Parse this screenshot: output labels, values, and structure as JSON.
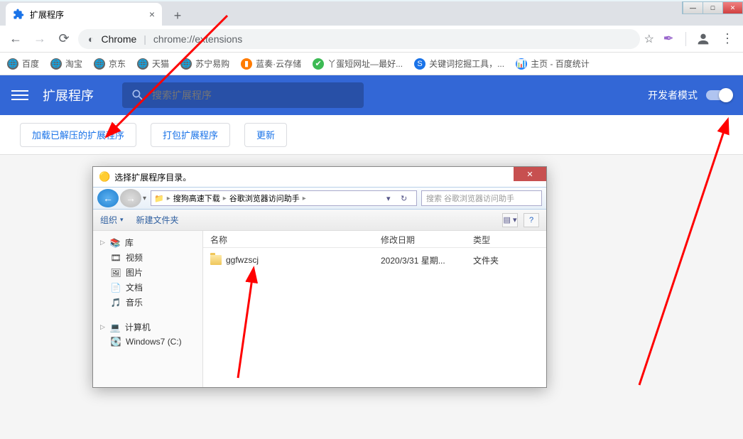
{
  "tab": {
    "title": "扩展程序"
  },
  "address": {
    "prefix": "Chrome",
    "url": "chrome://extensions"
  },
  "bookmarks": [
    {
      "icon_bg": "#666",
      "glyph": "🌐",
      "label": "百度"
    },
    {
      "icon_bg": "#666",
      "glyph": "🌐",
      "label": "淘宝"
    },
    {
      "icon_bg": "#666",
      "glyph": "🌐",
      "label": "京东"
    },
    {
      "icon_bg": "#666",
      "glyph": "🌐",
      "label": "天猫"
    },
    {
      "icon_bg": "#666",
      "glyph": "🌐",
      "label": "苏宁易购"
    },
    {
      "icon_bg": "#ff7b00",
      "glyph": "▮",
      "label": "蓝奏·云存储"
    },
    {
      "icon_bg": "#3cba54",
      "glyph": "✔",
      "label": "丫蛋短网址—最好..."
    },
    {
      "icon_bg": "#1a73e8",
      "glyph": "S",
      "label": "关键词挖掘工具，..."
    },
    {
      "icon_bg": "#2080ff",
      "glyph": "📊",
      "label": "主页 - 百度统计"
    }
  ],
  "ext_header": {
    "title": "扩展程序",
    "search_placeholder": "搜索扩展程序",
    "dev_mode_label": "开发者模式"
  },
  "ext_buttons": {
    "load_unpacked": "加载已解压的扩展程序",
    "pack": "打包扩展程序",
    "update": "更新"
  },
  "dialog": {
    "title": "选择扩展程序目录。",
    "breadcrumb": [
      "搜狗高速下载",
      "谷歌浏览器访问助手"
    ],
    "search_placeholder": "搜索 谷歌浏览器访问助手",
    "toolbar": {
      "organize": "组织",
      "new_folder": "新建文件夹"
    },
    "sidebar": {
      "library": "库",
      "items": [
        "视频",
        "图片",
        "文档",
        "音乐"
      ],
      "computer": "计算机",
      "drives": [
        "Windows7 (C:)"
      ]
    },
    "file_headers": {
      "name": "名称",
      "date": "修改日期",
      "type": "类型"
    },
    "files": [
      {
        "name": "ggfwzscj",
        "date": "2020/3/31 星期...",
        "type": "文件夹"
      }
    ]
  }
}
